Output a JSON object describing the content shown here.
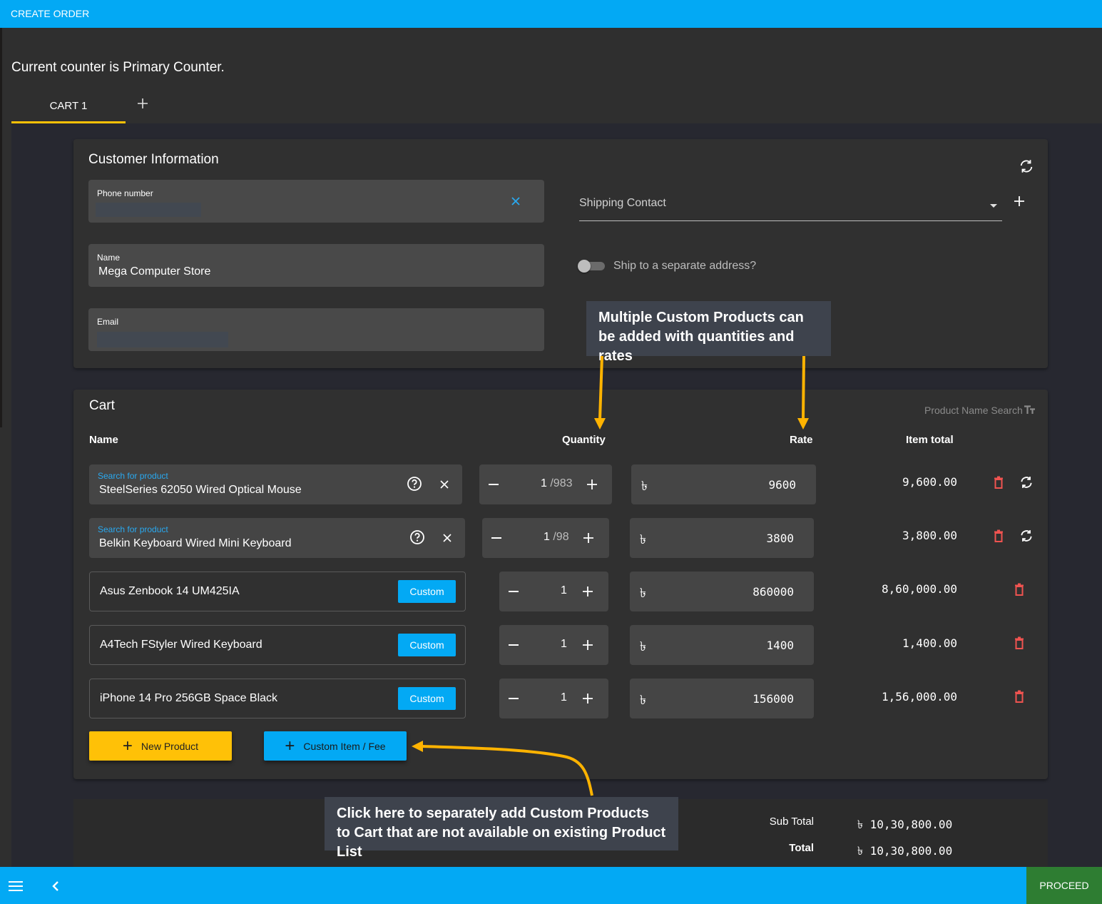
{
  "header": {
    "title": "CREATE ORDER"
  },
  "counter_text": "Current counter is Primary Counter.",
  "tabs": [
    {
      "label": "CART 1",
      "active": true
    }
  ],
  "customer": {
    "title": "Customer Information",
    "phone": {
      "label": "Phone number",
      "value": ""
    },
    "name": {
      "label": "Name",
      "value": "Mega Computer Store"
    },
    "email": {
      "label": "Email",
      "value": ""
    },
    "shipping_contact": {
      "placeholder": "Shipping Contact"
    },
    "ship_separate": {
      "label": "Ship to a separate address?",
      "checked": false
    }
  },
  "annotations": {
    "top": "Multiple Custom Products can be added with quantities and rates",
    "bottom": "Click here to separately add Custom Products to Cart that are not available on existing Product List",
    "color": "#ffb300"
  },
  "cart": {
    "title": "Cart",
    "search_mode": "Product Name Search",
    "columns": {
      "name": "Name",
      "quantity": "Quantity",
      "rate": "Rate",
      "item_total": "Item total"
    },
    "currency_symbol": "৳",
    "rows": [
      {
        "type": "search",
        "label": "Search for product",
        "name": "SteelSeries 62050 Wired Optical Mouse",
        "qty": "1",
        "max": "/983",
        "rate": "9600",
        "total": "9,600.00"
      },
      {
        "type": "search",
        "label": "Search for product",
        "name": "Belkin Keyboard Wired Mini Keyboard",
        "qty": "1",
        "max": "/98",
        "rate": "3800",
        "total": "3,800.00"
      },
      {
        "type": "custom",
        "name": "Asus Zenbook 14 UM425IA",
        "badge": "Custom",
        "qty": "1",
        "rate": "860000",
        "total": "8,60,000.00"
      },
      {
        "type": "custom",
        "name": "A4Tech FStyler Wired Keyboard",
        "badge": "Custom",
        "qty": "1",
        "rate": "1400",
        "total": "1,400.00"
      },
      {
        "type": "custom",
        "name": "iPhone 14 Pro 256GB Space Black",
        "badge": "Custom",
        "qty": "1",
        "rate": "156000",
        "total": "1,56,000.00"
      }
    ],
    "new_product_label": "New Product",
    "custom_item_label": "Custom Item / Fee"
  },
  "totals": {
    "sub_total_label": "Sub Total",
    "sub_total": "৳ 10,30,800.00",
    "total_label": "Total",
    "total": "৳ 10,30,800.00"
  },
  "footer": {
    "proceed_label": "PROCEED"
  },
  "colors": {
    "primary": "#03a9f4",
    "accent": "#ffc107",
    "proceed": "#2e7d32",
    "danger": "#ef5350"
  }
}
